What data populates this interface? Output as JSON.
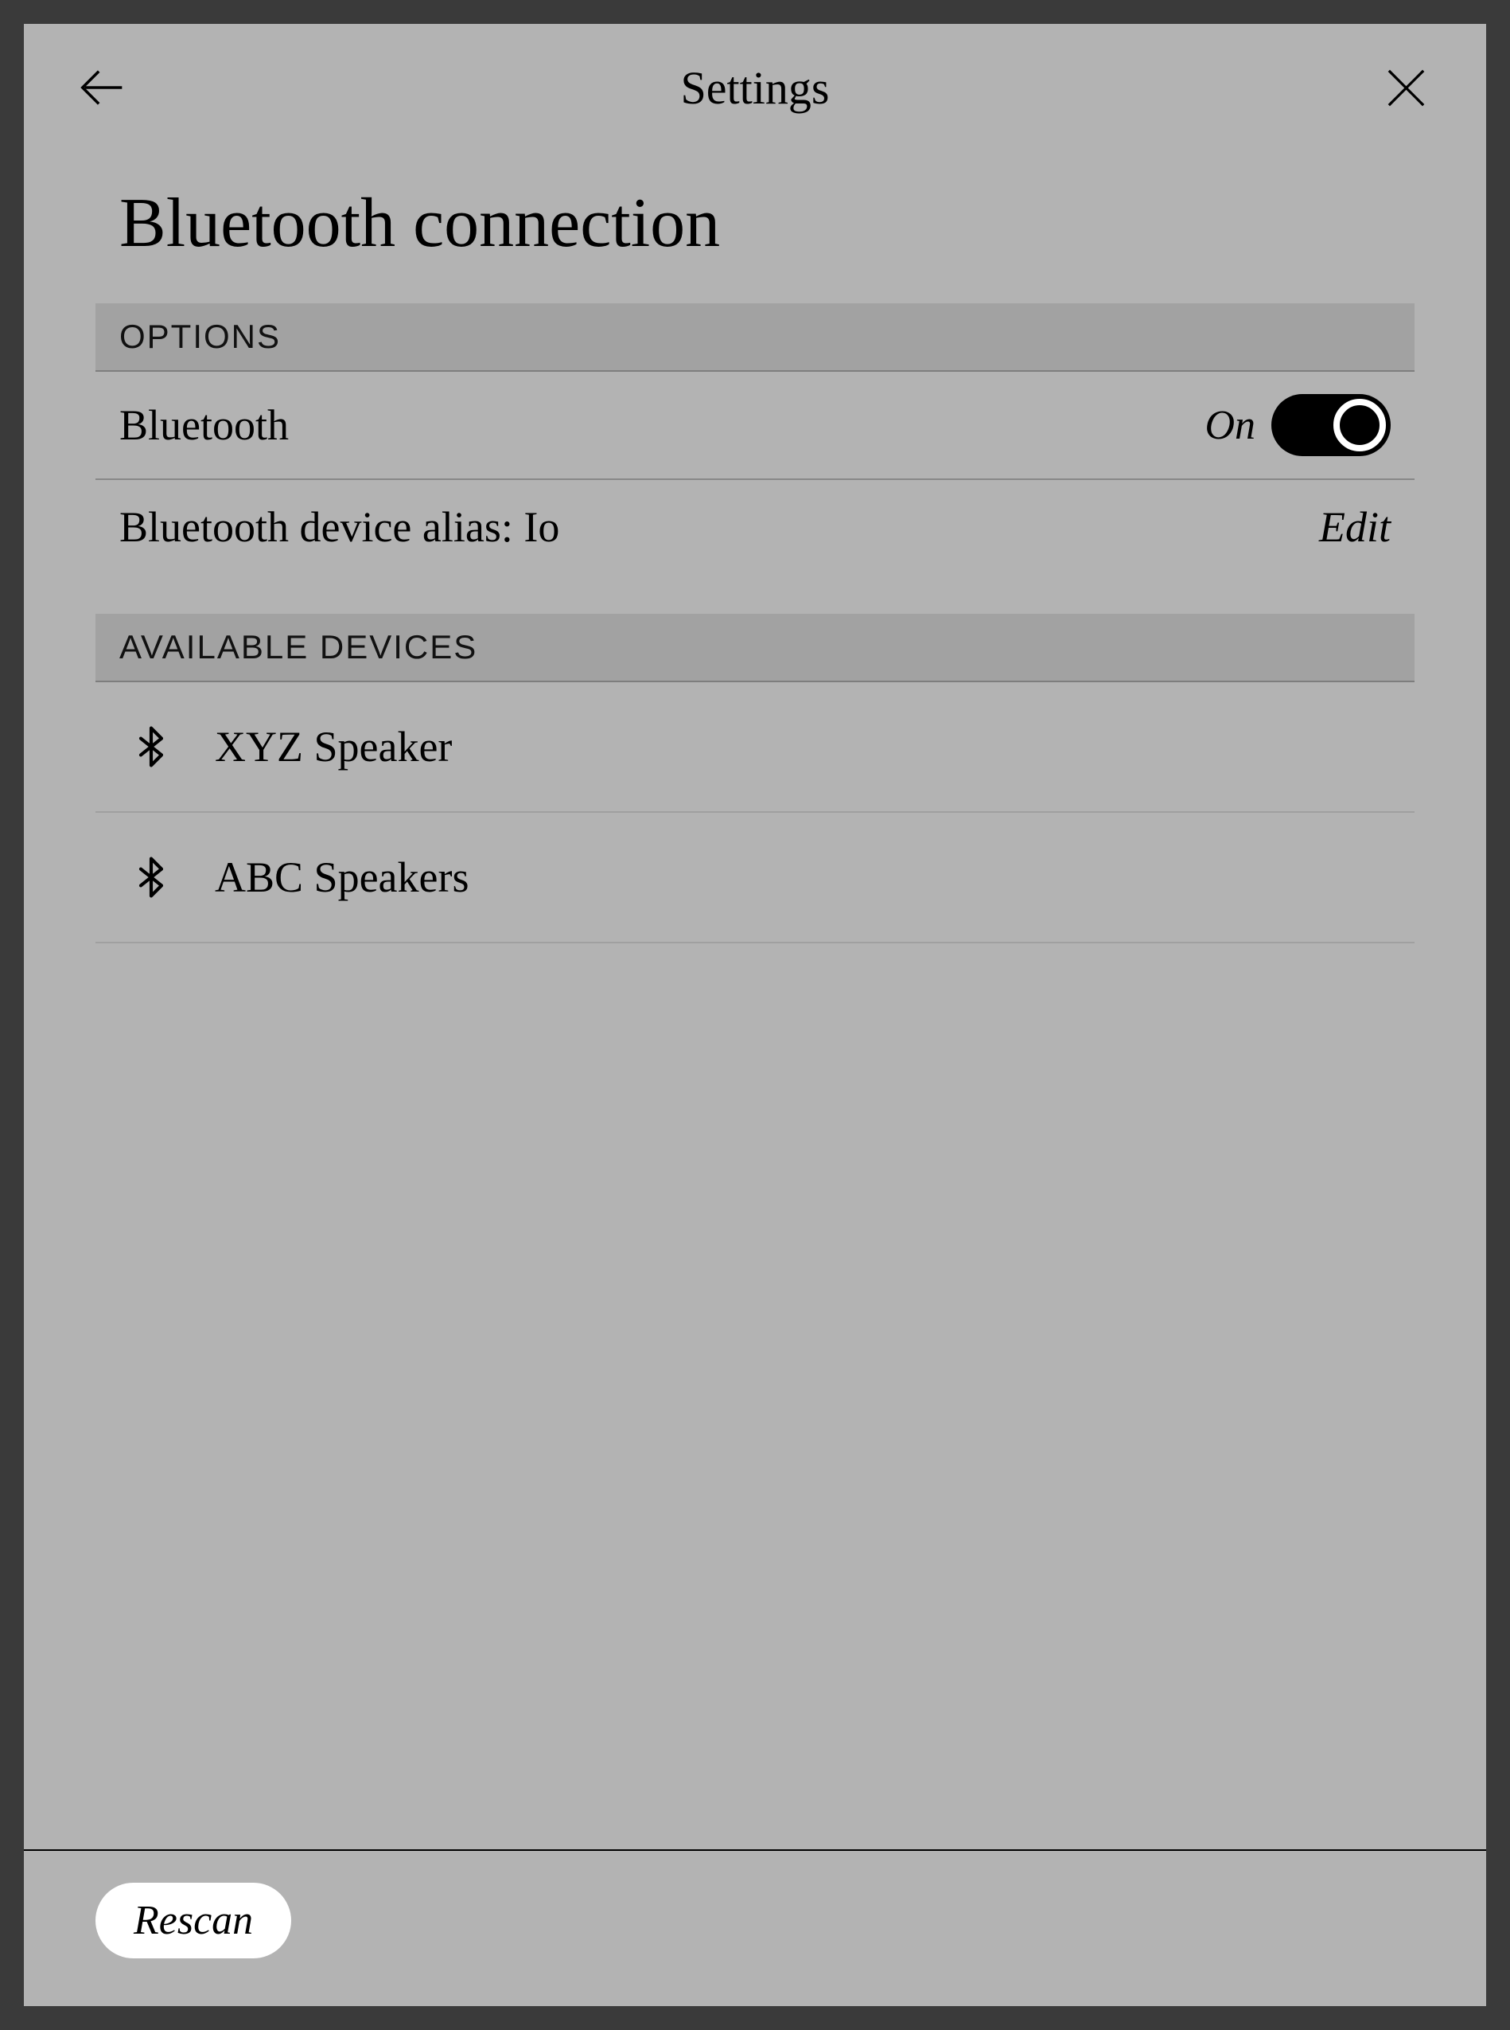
{
  "header": {
    "title": "Settings"
  },
  "page": {
    "title": "Bluetooth connection"
  },
  "sections": {
    "options": {
      "header": "OPTIONS",
      "bluetooth_label": "Bluetooth",
      "bluetooth_state": "On",
      "alias_row_text": "Bluetooth device alias: Io",
      "edit_label": "Edit"
    },
    "available": {
      "header": "AVAILABLE DEVICES",
      "devices": [
        {
          "name": "XYZ Speaker"
        },
        {
          "name": "ABC Speakers"
        }
      ]
    }
  },
  "footer": {
    "rescan_label": "Rescan"
  }
}
